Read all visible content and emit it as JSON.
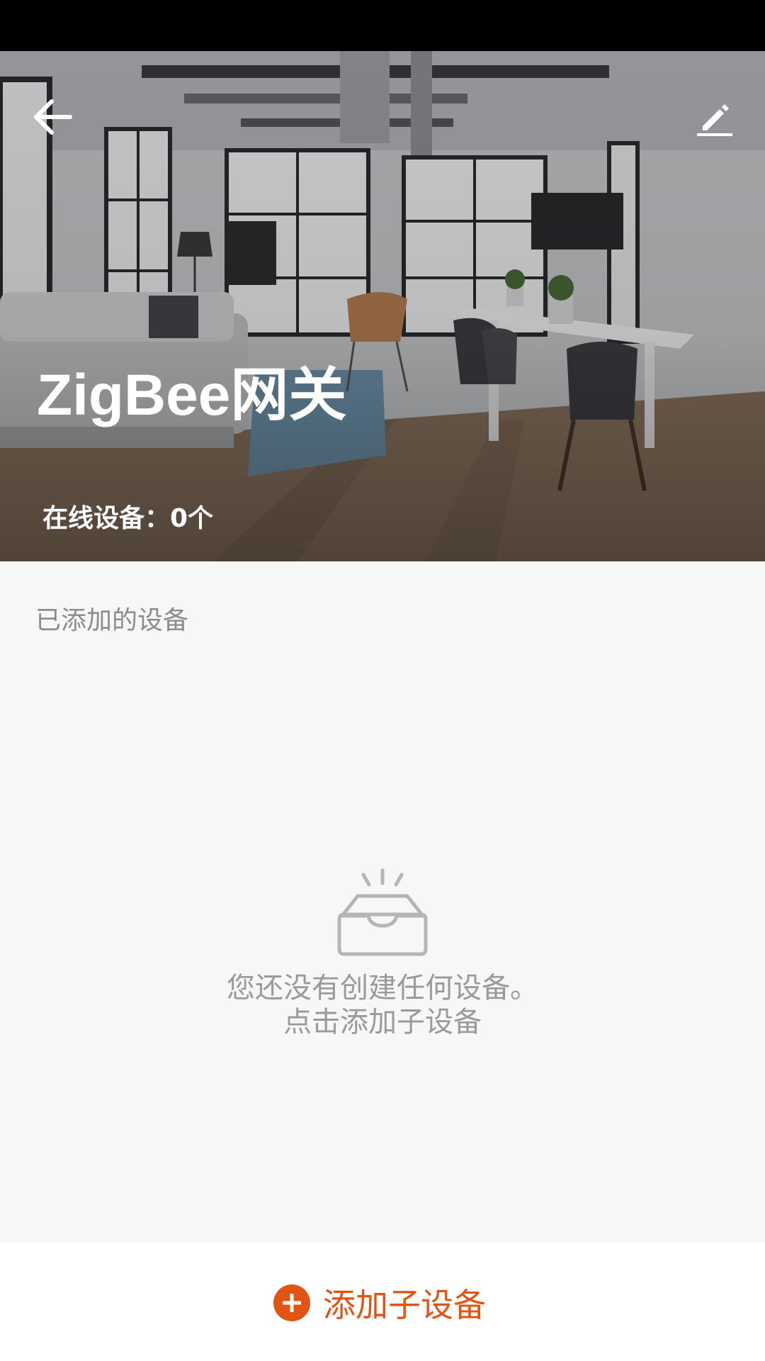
{
  "header": {
    "title": "ZigBee网关",
    "online_devices": "在线设备：0个",
    "back_icon": "arrow-left-icon",
    "edit_icon": "pencil-icon"
  },
  "main": {
    "section_label": "已添加的设备",
    "empty_icon": "empty-inbox-icon",
    "empty_message_line1": "您还没有创建任何设备。",
    "empty_message_line2": "点击添加子设备"
  },
  "footer": {
    "add_label": "添加子设备",
    "add_icon": "plus-circle-icon"
  },
  "colors": {
    "accent": "#e25414",
    "background": "#f7f7f7",
    "muted_text": "#9a9a9a"
  }
}
